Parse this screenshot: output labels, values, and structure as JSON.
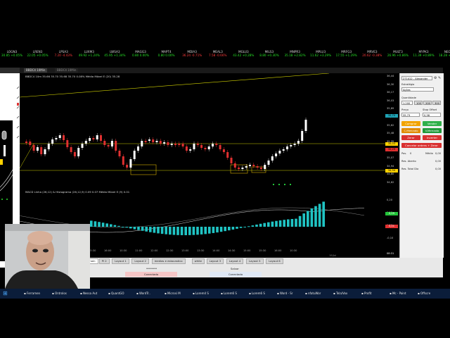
{
  "ticker": [
    {
      "sym": "LOGN3",
      "val": "30.85 +0.05%",
      "dir": "up"
    },
    {
      "sym": "LREN3",
      "val": "22.05 +0.05%",
      "dir": "up"
    },
    {
      "sym": "LPSA3",
      "val": "7.20 -4.43%",
      "dir": "dn"
    },
    {
      "sym": "LUXM3",
      "val": "49.92 +1.24%",
      "dir": "up"
    },
    {
      "sym": "LWSA3",
      "val": "45.95 +1.34%",
      "dir": "up"
    },
    {
      "sym": "MAGG3",
      "val": "0.80 0.00%",
      "dir": "up"
    },
    {
      "sym": "MAPT4",
      "val": "0.80 0.00%",
      "dir": "up"
    },
    {
      "sym": "MDIA3",
      "val": "36.24 -0.71%",
      "dir": "dn"
    },
    {
      "sym": "MEAL3",
      "val": "7.58 -0.66%",
      "dir": "dn"
    },
    {
      "sym": "MGLU3",
      "val": "43.42 +0.28%",
      "dir": "up"
    },
    {
      "sym": "MILS3",
      "val": "8.80 +0.30%",
      "dir": "up"
    },
    {
      "sym": "MNPR3",
      "val": "35.18 +2.82%",
      "dir": "up"
    },
    {
      "sym": "MPLU3",
      "val": "11.62 +3.29%",
      "dir": "up"
    },
    {
      "sym": "MRFG3",
      "val": "17.55 +1.29%",
      "dir": "up"
    },
    {
      "sym": "MRVE3",
      "val": "20.62 -0.38%",
      "dir": "dn"
    },
    {
      "sym": "MULT3",
      "val": "26.96 +0.86%",
      "dir": "up"
    },
    {
      "sym": "MYPK3",
      "val": "11.39 +0.89%",
      "dir": "up"
    },
    {
      "sym": "NEOE3",
      "val": "18.28 +0.23%",
      "dir": "up"
    },
    {
      "sym": "NATU3",
      "val": "51.11 -0.35%",
      "dir": "dn"
    },
    {
      "sym": "ODPV3",
      "val": "16.91 +0.81%",
      "dir": "up"
    }
  ],
  "tabs": {
    "active": "BBDC4 10Min",
    "second": "BBDC4 10Min"
  },
  "chart": {
    "legend": "BBDC4 10m  35.66  35.70  35.68  35.70  0.08%  Média Móvel E (20)  35.28",
    "macd_legend": "MACD Linha (26,12) & Histograma (26,12,9)  0.09  0.07  Média Móvel E (9)  0.01",
    "times": [
      "15:30",
      "16:00",
      "10:30",
      "11:00",
      "12:00",
      "12:30",
      "13:00",
      "13:30",
      "14:00",
      "14:30",
      "15:00",
      "15:30",
      "16:00",
      "10:30"
    ],
    "date_label": "19/Jul"
  },
  "yaxis": {
    "labels": [
      "36,44",
      "36,30",
      "36,17",
      "36,03",
      "35,89",
      "35,76",
      "35,62",
      "35,48",
      "35,35",
      "35,21",
      "35,07",
      "34,94",
      "34,80",
      "34,62"
    ],
    "badge_price": "35,70",
    "badge_ma": "35,29",
    "badge_low": "35,03",
    "badge_x": "34,94",
    "macd_labels": [
      "0,20",
      "0,10",
      "0,00",
      "-0,10"
    ],
    "macd_badge_g": "0,09",
    "macd_badge_r": "0,01",
    "clock": "08:31"
  },
  "panel": {
    "account": "271412 - Alexander",
    "strategy_label": "Estratégia",
    "strategy": "Ações",
    "qty_label": "Quantidade",
    "qty": "1.200",
    "q100": "100",
    "q200": "200",
    "q300": "300",
    "price_label": "Preço",
    "stop_label": "Stop Offset",
    "price": "35,73",
    "stop": "0,38",
    "buy": "Comprar",
    "sell": "Vender",
    "buy_mkt": "C.Mercado",
    "sell_mkt": "V.Mercado",
    "zero": "Zerar",
    "invert": "Inverter",
    "cancel": "Cancelar ordens + Zerar",
    "pos_label": "Pos.",
    "pos_val": "0",
    "avg_label": "Média",
    "avg_val": "0,00",
    "open_label": "Res. Aberto",
    "open_val": "0,00",
    "total_label": "Res. Total Dia",
    "total_val": "0,00"
  },
  "bottom": {
    "tabs": [
      "main",
      "PI 2",
      "Layout 1",
      "Layout 2",
      "medias e estocastico",
      "white",
      "Layout 3",
      "Layout 4",
      "Layout 5",
      "Layout 6"
    ],
    "conn1": "Conectado",
    "conn2": "Conectado",
    "conn3": "Conectado",
    "save": "Salvar",
    "user": "********"
  },
  "taskbar": [
    "Ferramen",
    "Ontrolos",
    "Nessa Aut",
    "QuantGO",
    "WordTr..",
    "Microsi M",
    "Lorem4 S",
    "Lorem6 S",
    "Lorem6 S",
    "Word - Sr",
    "nfatuWor",
    "Tela/Vox",
    "Profit",
    "Mc - Paint",
    "Offscre"
  ]
}
